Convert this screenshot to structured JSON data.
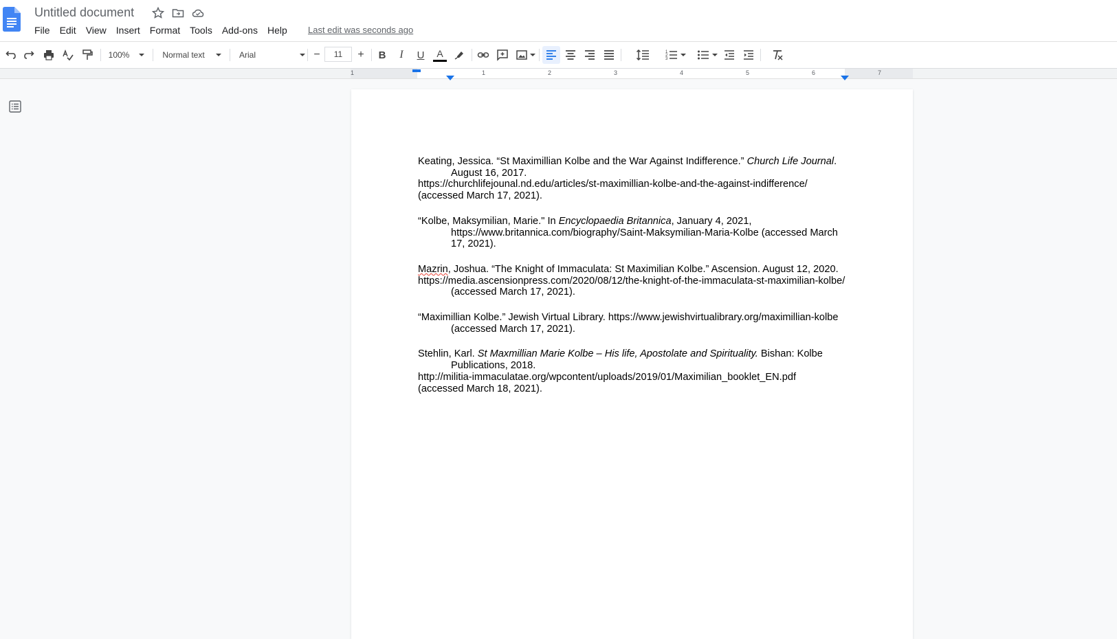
{
  "app": {
    "title": "Untitled document",
    "last_edit": "Last edit was seconds ago",
    "brand_color": "#4285f4"
  },
  "menu": [
    "File",
    "Edit",
    "View",
    "Insert",
    "Format",
    "Tools",
    "Add-ons",
    "Help"
  ],
  "toolbar": {
    "zoom": "100%",
    "style": "Normal text",
    "font": "Arial",
    "font_size": "11",
    "minus": "−",
    "plus": "+",
    "bold": "B",
    "italic": "I",
    "underline": "U",
    "text_color_label": "A"
  },
  "ruler": {
    "numbers": [
      "1",
      "1",
      "2",
      "3",
      "4",
      "5",
      "6",
      "7"
    ]
  },
  "document": {
    "refs": [
      {
        "a": "Keating, Jessica. “St Maximillian Kolbe and the War Against Indifference.” ",
        "b": "Church Life Journal",
        "c": ". August 16, 2017.",
        "d": "https://churchlifejounal.nd.edu/articles/st-maximillian-kolbe-and-the-against-indifference/",
        "e": "(accessed March 17, 2021)."
      },
      {
        "a": "“Kolbe, Maksymilian, Marie.\" In ",
        "b": "Encyclopaedia Britannica",
        "c": ", January 4, 2021,",
        "d": "https://www.britannica.com/biography/Saint-Maksymilian-Maria-Kolbe (accessed March 17, 2021)."
      },
      {
        "a": "Mazrin",
        "b": ", Joshua. “The Knight of Immaculata: St Maximilian Kolbe.” Ascension. August 12, 2020.",
        "c": "https://media.ascensionpress.com/2020/08/12/the-knight-of-the-immaculata-st-maximilian-kolbe/ (accessed March 17, 2021)."
      },
      {
        "a": "“Maximillian Kolbe.” Jewish Virtual Library. https://www.jewishvirtualibrary.org/maximillian-kolbe (accessed March 17, 2021)."
      },
      {
        "a": "Stehlin, Karl. ",
        "b": "St Maxmillian Marie Kolbe – His life, Apostolate and Spirituality.",
        "c": " Bishan: Kolbe Publications, 2018.",
        "d": "http://militia-immaculatae.org/wpcontent/uploads/2019/01/Maximilian_booklet_EN.pdf",
        "e": "(accessed March 18, 2021)."
      }
    ]
  }
}
